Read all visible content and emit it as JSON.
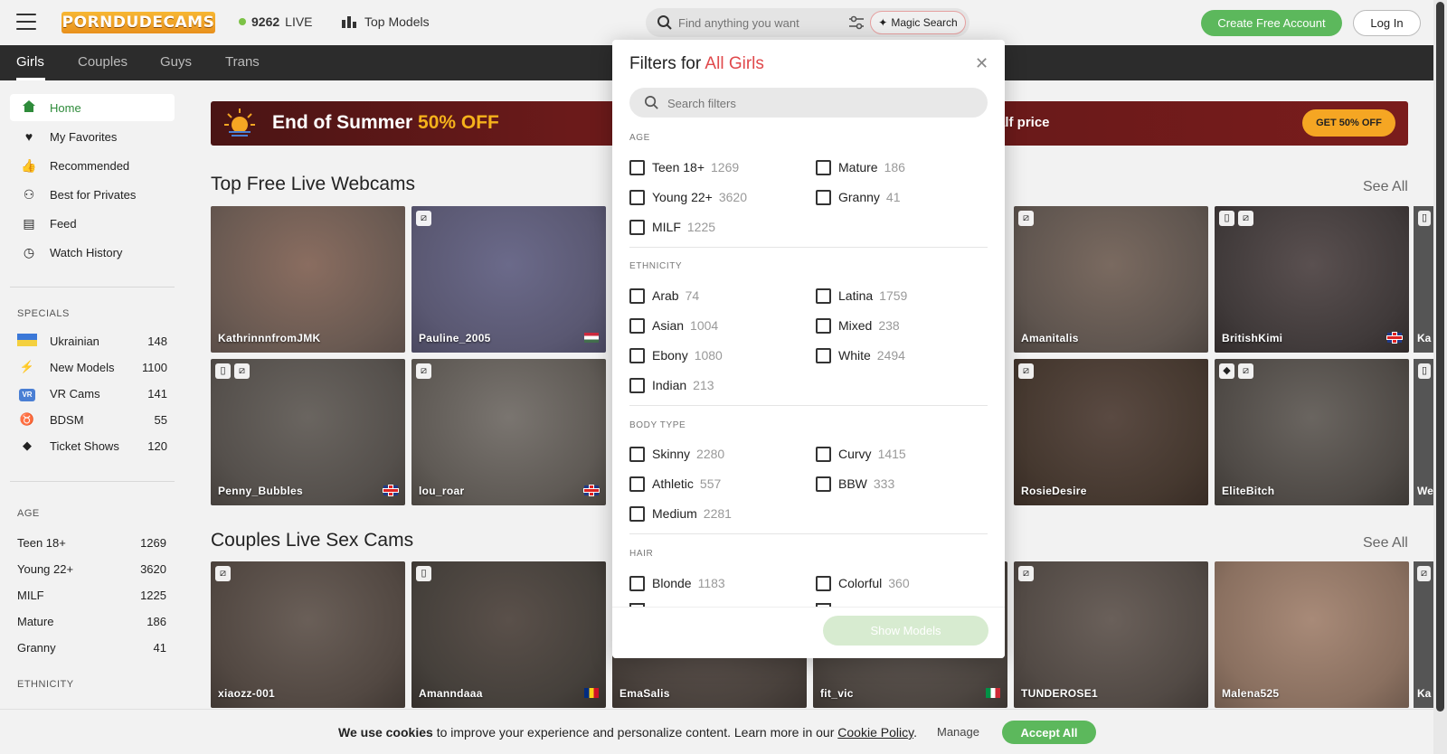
{
  "header": {
    "logo_text": "PORNDUDECAMS",
    "live_count": "9262",
    "live_label": "LIVE",
    "top_models": "Top Models",
    "search_placeholder": "Find anything you want",
    "magic_search": "Magic Search",
    "create_account": "Create Free Account",
    "login": "Log In"
  },
  "categories": [
    "Girls",
    "Couples",
    "Guys",
    "Trans"
  ],
  "sidebar": {
    "nav": [
      {
        "label": "Home",
        "icon": "home-icon"
      },
      {
        "label": "My Favorites",
        "icon": "heart-icon"
      },
      {
        "label": "Recommended",
        "icon": "thumbs-up-icon"
      },
      {
        "label": "Best for Privates",
        "icon": "private-icon"
      },
      {
        "label": "Feed",
        "icon": "feed-icon"
      },
      {
        "label": "Watch History",
        "icon": "history-icon"
      }
    ],
    "specials_heading": "SPECIALS",
    "specials": [
      {
        "label": "Ukrainian",
        "count": "148"
      },
      {
        "label": "New Models",
        "count": "1100"
      },
      {
        "label": "VR Cams",
        "count": "141",
        "badge": "VR"
      },
      {
        "label": "BDSM",
        "count": "55"
      },
      {
        "label": "Ticket Shows",
        "count": "120"
      }
    ],
    "age_heading": "AGE",
    "ages": [
      {
        "label": "Teen 18+",
        "count": "1269"
      },
      {
        "label": "Young 22+",
        "count": "3620"
      },
      {
        "label": "MILF",
        "count": "1225"
      },
      {
        "label": "Mature",
        "count": "186"
      },
      {
        "label": "Granny",
        "count": "41"
      }
    ],
    "ethnicity_heading": "ETHNICITY"
  },
  "banner": {
    "title_main": "End of Summer",
    "title_accent": "50% OFF",
    "subtitle": "alf price",
    "button": "GET 50% OFF"
  },
  "sections": {
    "free_title": "Top Free Live Webcams",
    "couples_title": "Couples Live Sex Cams",
    "see_all": "See All"
  },
  "models": {
    "row1": [
      "KathrinnnfromJMK",
      "Pauline_2005",
      "",
      "",
      "Amanitalis",
      "BritishKimi",
      "Ka"
    ],
    "row2": [
      "Penny_Bubbles",
      "lou_roar",
      "",
      "",
      "RosieDesire",
      "EliteBitch",
      "We"
    ],
    "row3": [
      "xiaozz-001",
      "Amanndaaa",
      "EmaSalis",
      "fit_vic",
      "TUNDEROSE1",
      "Malena525",
      "Ka"
    ]
  },
  "filters": {
    "title_prefix": "Filters for",
    "title_accent": "All Girls",
    "search_placeholder": "Search filters",
    "age_heading": "AGE",
    "age": [
      {
        "label": "Teen 18+",
        "count": "1269"
      },
      {
        "label": "Mature",
        "count": "186"
      },
      {
        "label": "Young 22+",
        "count": "3620"
      },
      {
        "label": "Granny",
        "count": "41"
      },
      {
        "label": "MILF",
        "count": "1225"
      }
    ],
    "ethnicity_heading": "ETHNICITY",
    "ethnicity": [
      {
        "label": "Arab",
        "count": "74"
      },
      {
        "label": "Latina",
        "count": "1759"
      },
      {
        "label": "Asian",
        "count": "1004"
      },
      {
        "label": "Mixed",
        "count": "238"
      },
      {
        "label": "Ebony",
        "count": "1080"
      },
      {
        "label": "White",
        "count": "2494"
      },
      {
        "label": "Indian",
        "count": "213"
      }
    ],
    "body_heading": "BODY TYPE",
    "body": [
      {
        "label": "Skinny",
        "count": "2280"
      },
      {
        "label": "Curvy",
        "count": "1415"
      },
      {
        "label": "Athletic",
        "count": "557"
      },
      {
        "label": "BBW",
        "count": "333"
      },
      {
        "label": "Medium",
        "count": "2281"
      }
    ],
    "hair_heading": "HAIR",
    "hair": [
      {
        "label": "Blonde",
        "count": "1183"
      },
      {
        "label": "Colorful",
        "count": "360"
      }
    ],
    "show_button": "Show Models"
  },
  "cookie": {
    "bold1": "We use cookies",
    "text": "to improve your experience and personalize content. Learn more in our",
    "link": "Cookie Policy",
    "end": ".",
    "manage": "Manage",
    "accept": "Accept All"
  },
  "colors": {
    "green": "#5cb85c",
    "accent_red": "#e0484b",
    "banner_orange": "#f5a623"
  }
}
